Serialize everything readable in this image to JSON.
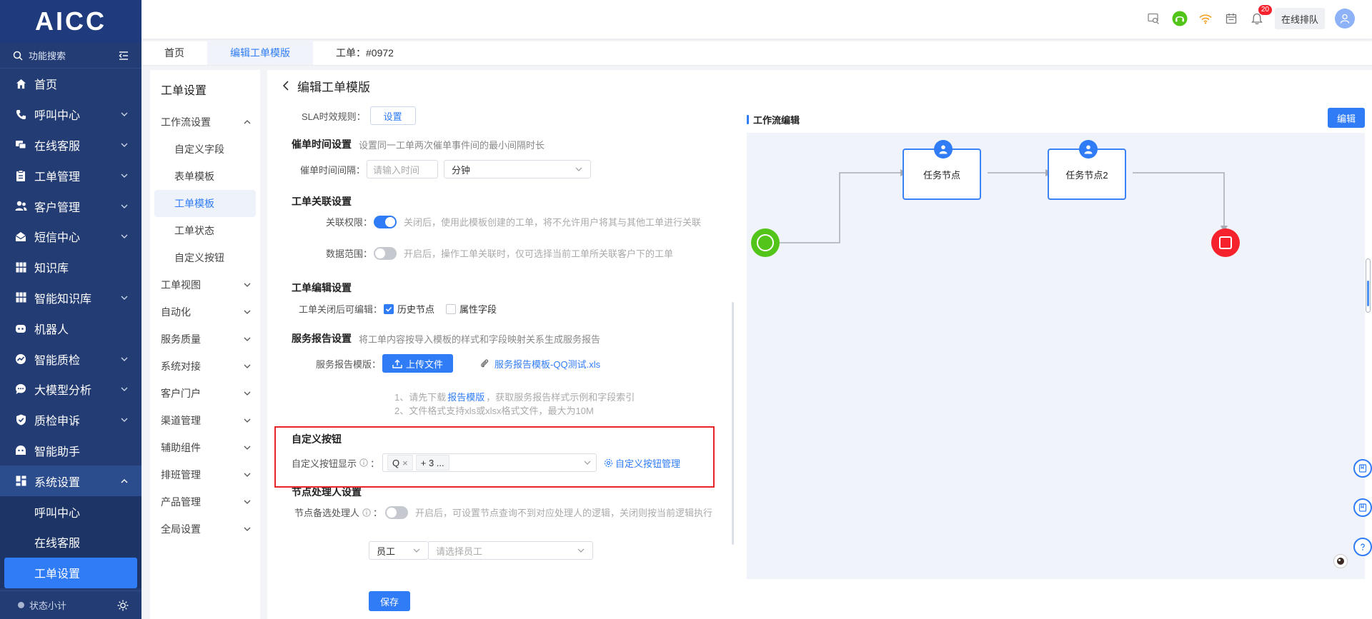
{
  "nav": {
    "logo": "AICC",
    "search_label": "功能搜索",
    "items": [
      {
        "label": "首页",
        "icon": "home-icon"
      },
      {
        "label": "呼叫中心",
        "icon": "phone-icon"
      },
      {
        "label": "在线客服",
        "icon": "chat-icon"
      },
      {
        "label": "工单管理",
        "icon": "clipboard-icon"
      },
      {
        "label": "客户管理",
        "icon": "users-icon"
      },
      {
        "label": "短信中心",
        "icon": "envelope-icon"
      },
      {
        "label": "知识库",
        "icon": "grid-icon"
      },
      {
        "label": "智能知识库",
        "icon": "grid-icon"
      },
      {
        "label": "机器人",
        "icon": "robot-icon"
      },
      {
        "label": "智能质检",
        "icon": "gauge-icon"
      },
      {
        "label": "大模型分析",
        "icon": "bubble-icon"
      },
      {
        "label": "质检申诉",
        "icon": "shield-check-icon"
      },
      {
        "label": "智能助手",
        "icon": "assistant-icon"
      },
      {
        "label": "系统设置",
        "icon": "dashboard-icon"
      }
    ],
    "sub_items": [
      "呼叫中心",
      "在线客服",
      "工单设置"
    ],
    "footer_label": "状态小计"
  },
  "header": {
    "notification_count": "20",
    "queue_label": "在线排队"
  },
  "tabs": [
    "首页",
    "编辑工单模版",
    "工单：#0972"
  ],
  "settings_menu": {
    "title": "工单设置",
    "group_open": "工作流设置",
    "sub_items": [
      "自定义字段",
      "表单模板",
      "工单模板",
      "工单状态",
      "自定义按钮"
    ],
    "groups": [
      "工单视图",
      "自动化",
      "服务质量",
      "系统对接",
      "客户门户",
      "渠道管理",
      "辅助组件",
      "排班管理",
      "产品管理",
      "全局设置"
    ]
  },
  "page": {
    "back_title": "编辑工单模版",
    "save_label": "保存"
  },
  "form": {
    "sla_label": "SLA时效规则：",
    "sla_button": "设置",
    "remind_title": "催单时间设置",
    "remind_hint": "设置同一工单两次催单事件间的最小间隔时长",
    "remind_interval_label": "催单时间间隔：",
    "remind_placeholder": "请输入时间",
    "remind_unit": "分钟",
    "relation_title": "工单关联设置",
    "relation_perm_label": "关联权限：",
    "relation_perm_hint": "关闭后，使用此模板创建的工单，将不允许用户将其与其他工单进行关联",
    "data_scope_label": "数据范围：",
    "data_scope_hint": "开启后，操作工单关联时，仅可选择当前工单所关联客户下的工单",
    "edit_title": "工单编辑设置",
    "editable_label": "工单关闭后可编辑：",
    "history_node": "历史节点",
    "attr_field": "属性字段",
    "report_title": "服务报告设置",
    "report_hint": "将工单内容按导入模板的样式和字段映射关系生成服务报告",
    "report_template_label": "服务报告模版：",
    "upload_label": "上传文件",
    "report_file": "服务报告模板-QQ测试.xls",
    "note1_prefix": "1、请先下载",
    "note1_link": "报告模版",
    "note1_suffix": "，获取服务报告样式示例和字段索引",
    "note2": "2、文件格式支持xls或xlsx格式文件，最大为10M",
    "custom_btn_title": "自定义按钮",
    "custom_btn_label": "自定义按钮显示",
    "custom_btn_tag": "Q",
    "custom_btn_more": "+ 3 ...",
    "custom_btn_manage": "自定义按钮管理",
    "handler_title": "节点处理人设置",
    "handler_label": "节点备选处理人",
    "handler_hint": "开启后，可设置节点查询不到对应处理人的逻辑，关闭则按当前逻辑执行",
    "handler_type": "员工",
    "handler_placeholder": "请选择员工",
    "colon": "："
  },
  "workflow": {
    "title": "工作流编辑",
    "edit_label": "编辑",
    "node1": "任务节点",
    "node2": "任务节点2"
  },
  "colors": {
    "nav_bg": "#233c74",
    "primary": "#2f7cf6",
    "start": "#52c41a",
    "end": "#f5222d",
    "highlight_border": "#e8262a"
  }
}
